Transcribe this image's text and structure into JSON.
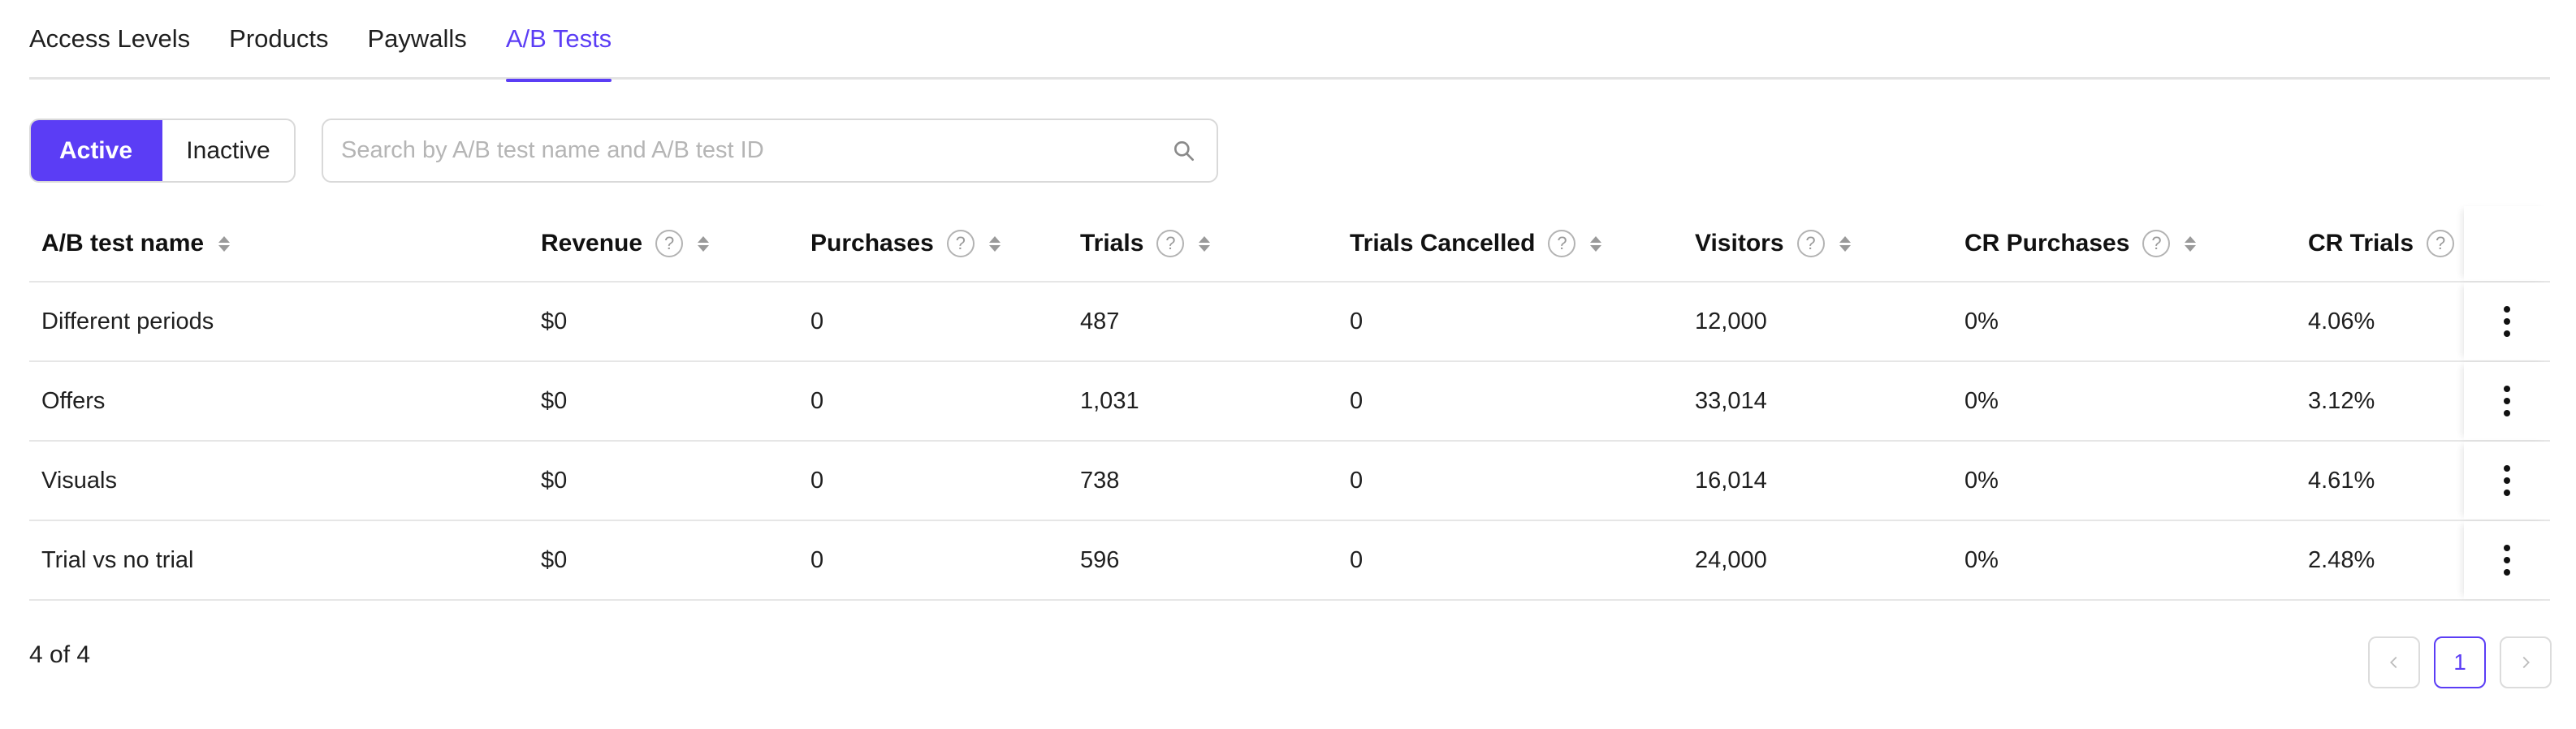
{
  "tabs": [
    {
      "label": "Access Levels",
      "active": false
    },
    {
      "label": "Products",
      "active": false
    },
    {
      "label": "Paywalls",
      "active": false
    },
    {
      "label": "A/B Tests",
      "active": true
    }
  ],
  "status_toggle": {
    "active_label": "Active",
    "inactive_label": "Inactive",
    "selected": "Active"
  },
  "search": {
    "placeholder": "Search by A/B test name and A/B test ID",
    "value": ""
  },
  "table": {
    "columns": [
      {
        "label": "A/B test name",
        "help": false,
        "sortable": true
      },
      {
        "label": "Revenue",
        "help": true,
        "sortable": true
      },
      {
        "label": "Purchases",
        "help": true,
        "sortable": true
      },
      {
        "label": "Trials",
        "help": true,
        "sortable": true
      },
      {
        "label": "Trials Cancelled",
        "help": true,
        "sortable": true
      },
      {
        "label": "Visitors",
        "help": true,
        "sortable": true
      },
      {
        "label": "CR Purchases",
        "help": true,
        "sortable": true
      },
      {
        "label": "CR Trials",
        "help": true,
        "sortable": true
      }
    ],
    "help_symbol": "?",
    "rows": [
      [
        "Different periods",
        "$0",
        "0",
        "487",
        "0",
        "12,000",
        "0%",
        "4.06%"
      ],
      [
        "Offers",
        "$0",
        "0",
        "1,031",
        "0",
        "33,014",
        "0%",
        "3.12%"
      ],
      [
        "Visuals",
        "$0",
        "0",
        "738",
        "0",
        "16,014",
        "0%",
        "4.61%"
      ],
      [
        "Trial vs no trial",
        "$0",
        "0",
        "596",
        "0",
        "24,000",
        "0%",
        "2.48%"
      ]
    ]
  },
  "footer": {
    "count_text": "4 of 4"
  },
  "pagination": {
    "current_page": "1"
  },
  "colors": {
    "accent": "#5b3df5",
    "border": "#d9d9d9",
    "muted": "#9a9a9a"
  }
}
